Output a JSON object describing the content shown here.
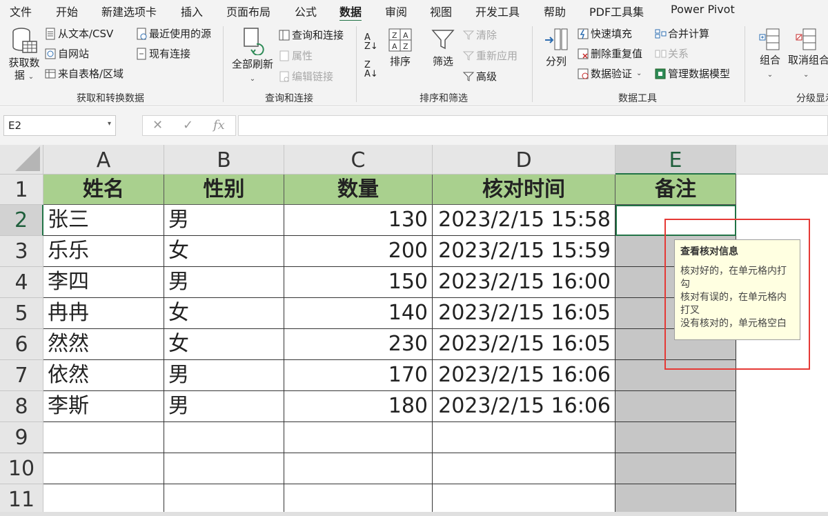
{
  "menu": {
    "tabs": [
      "文件",
      "开始",
      "新建选项卡",
      "插入",
      "页面布局",
      "公式",
      "数据",
      "审阅",
      "视图",
      "开发工具",
      "帮助",
      "PDF工具集",
      "Power Pivot"
    ],
    "active": "数据"
  },
  "ribbon": {
    "get_data": "获取数\n据",
    "from_text_csv": "从文本/CSV",
    "from_web": "自网站",
    "from_table": "来自表格/区域",
    "recent_sources": "最近使用的源",
    "existing_connections": "现有连接",
    "group_get_transform": "获取和转换数据",
    "refresh_all": "全部刷新",
    "queries_connections": "查询和连接",
    "properties": "属性",
    "edit_links": "编辑链接",
    "group_queries": "查询和连接",
    "sort": "排序",
    "filter": "筛选",
    "clear": "清除",
    "reapply": "重新应用",
    "advanced": "高级",
    "group_sort_filter": "排序和筛选",
    "text_to_columns": "分列",
    "flash_fill": "快速填充",
    "remove_duplicates": "删除重复值",
    "data_validation": "数据验证",
    "consolidate": "合并计算",
    "relationships": "关系",
    "manage_data_model": "管理数据模型",
    "group_data_tools": "数据工具",
    "group": "组合",
    "ungroup": "取消组合",
    "group_outline": "分级显示"
  },
  "formula_bar": {
    "name_box": "E2",
    "cancel": "✕",
    "enter": "✓",
    "fx": "fx",
    "content": ""
  },
  "sheet": {
    "columns": [
      "A",
      "B",
      "C",
      "D",
      "E"
    ],
    "rows": [
      "1",
      "2",
      "3",
      "4",
      "5",
      "6",
      "7",
      "8",
      "9",
      "10",
      "11"
    ],
    "header": [
      "姓名",
      "性别",
      "数量",
      "核对时间",
      "备注"
    ],
    "data": [
      [
        "张三",
        "男",
        "130",
        "2023/2/15 15:58",
        ""
      ],
      [
        "乐乐",
        "女",
        "200",
        "2023/2/15 15:59",
        ""
      ],
      [
        "李四",
        "男",
        "150",
        "2023/2/15 16:00",
        ""
      ],
      [
        "冉冉",
        "女",
        "140",
        "2023/2/15 16:05",
        ""
      ],
      [
        "然然",
        "女",
        "230",
        "2023/2/15 16:05",
        ""
      ],
      [
        "依然",
        "男",
        "170",
        "2023/2/15 16:06",
        ""
      ],
      [
        "李斯",
        "男",
        "180",
        "2023/2/15 16:06",
        ""
      ]
    ]
  },
  "tooltip": {
    "title": "查看核对信息",
    "lines": [
      "核对好的，在单元格内打",
      "勾",
      "核对有误的，在单元格内",
      "打叉",
      "没有核对的，单元格空白"
    ]
  },
  "colors": {
    "header_fill": "#a9d08e",
    "accent": "#217346",
    "highlight_box": "#e53935",
    "tooltip_bg": "#ffffe1"
  }
}
